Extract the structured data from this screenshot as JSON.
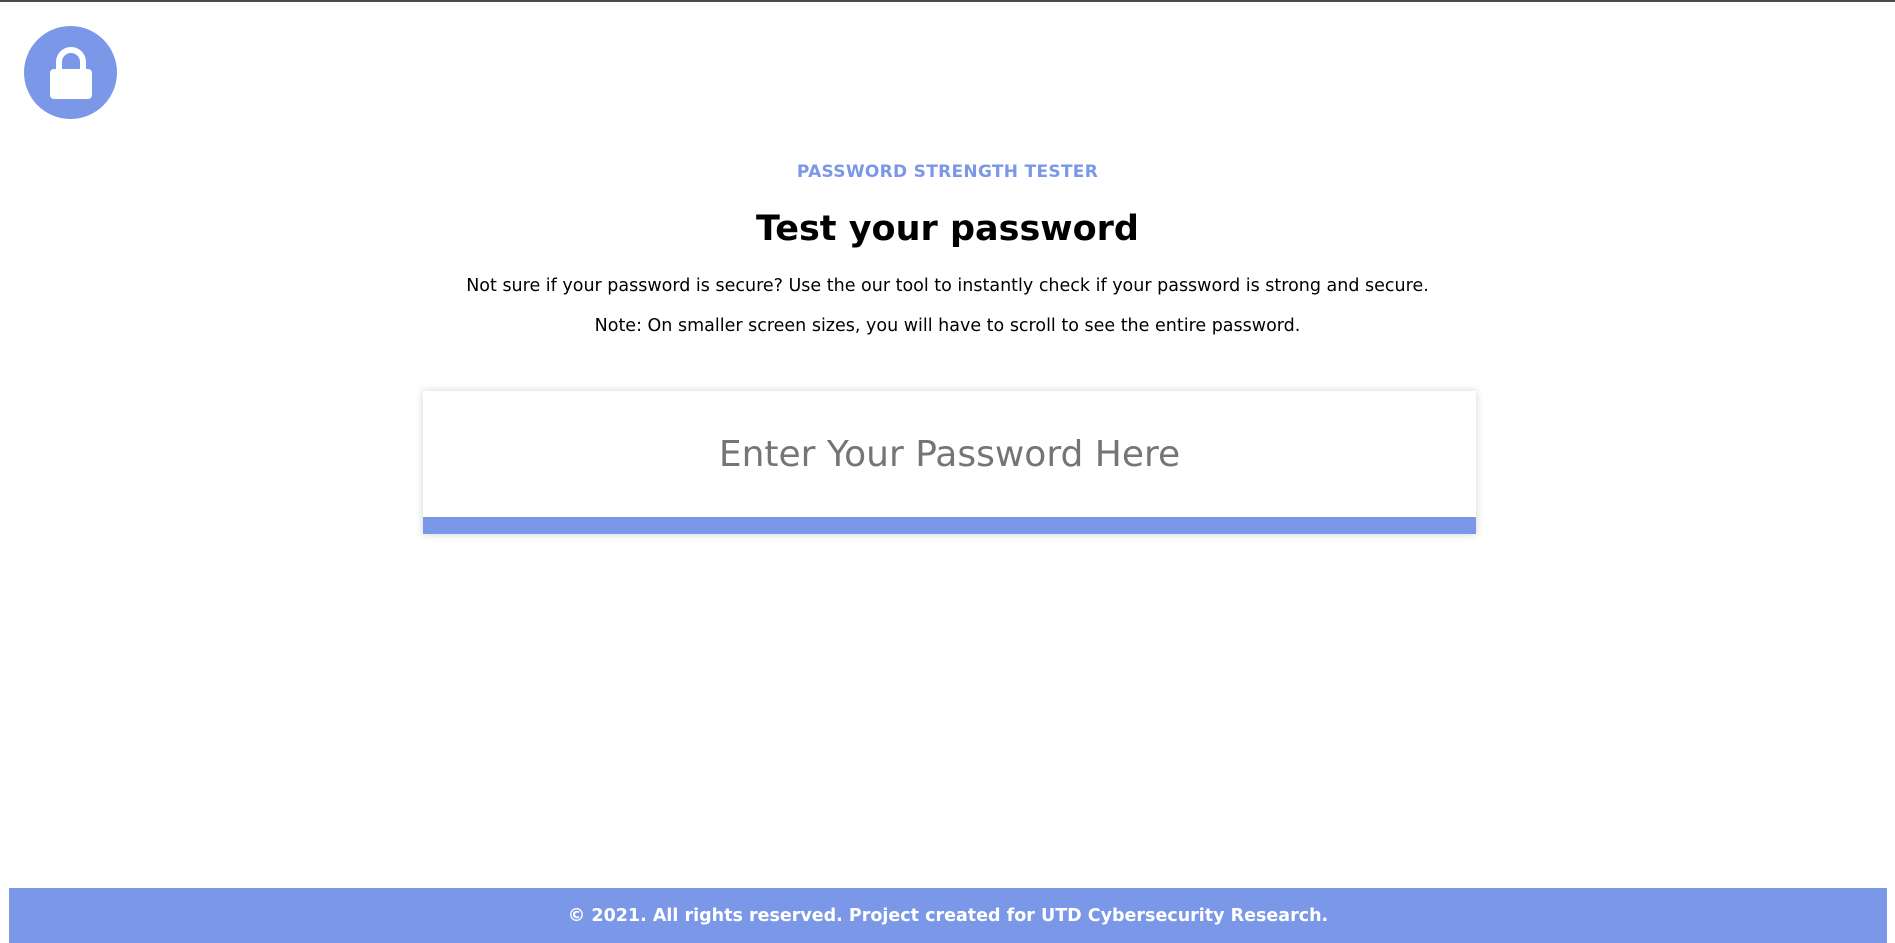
{
  "colors": {
    "accent": "#7b98e8",
    "eyebrow": "#7b98e8",
    "text": "#000000",
    "placeholder": "#757575"
  },
  "logo": {
    "icon": "lock-icon"
  },
  "header": {
    "eyebrow": "PASSWORD STRENGTH TESTER",
    "title": "Test your password",
    "description": "Not sure if your password is secure? Use the our tool to instantly check if your password is strong and secure.",
    "note": "Note: On smaller screen sizes, you will have to scroll to see the entire password."
  },
  "password_field": {
    "value": "",
    "placeholder": "Enter Your Password Here"
  },
  "strength_meter": {
    "fill_fraction": 1.0
  },
  "footer": {
    "text": "© 2021. All rights reserved. Project created for UTD Cybersecurity Research."
  }
}
